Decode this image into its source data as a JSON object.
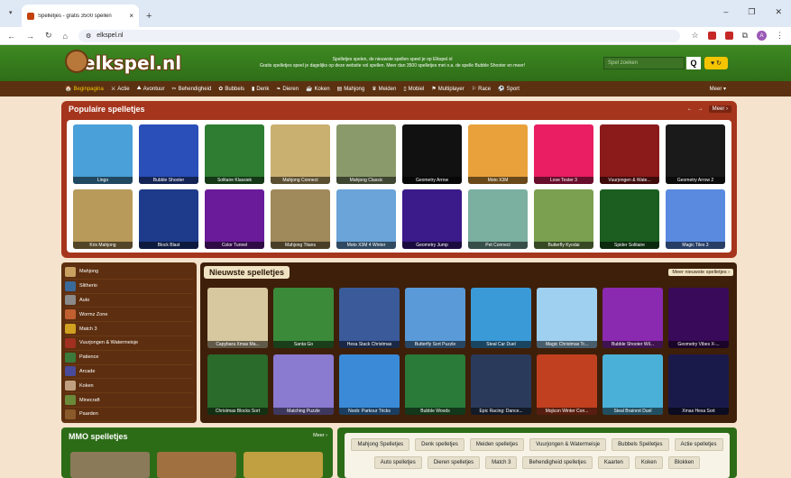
{
  "browser": {
    "tab_title": "Spelletjes - gratis 3500 spellen",
    "tab_close": "×",
    "new_tab": "+",
    "url": "elkspel.nl",
    "win_controls": [
      "–",
      "❐",
      "✕"
    ]
  },
  "header": {
    "logo": "elkspel.nl",
    "tagline_1": "Spelletjes spelen, de nieuwste spellen speel je op Elkspel.nl",
    "tagline_2": "Gratis spelletjes speel je dagelijks op deze website vol spellen. Meer dan 3500 spelletjes met o.a. de spelle Bubble Shooter en meer!",
    "search_placeholder": "Spel zoeken",
    "search_icon": "Q",
    "heart_label": "♥ ↻"
  },
  "nav": {
    "items": [
      "Beginpagina",
      "Actie",
      "Avontuur",
      "Behendigheid",
      "Bubbels",
      "Denk",
      "Dieren",
      "Koken",
      "Mahjong",
      "Meiden",
      "Mobiel",
      "Multiplayer",
      "Race",
      "Sport"
    ],
    "more": "Meer ▾"
  },
  "populaire": {
    "title": "Populaire spelletjes",
    "more": "Meer ›",
    "games": [
      "Lingo",
      "Bubble Shooter",
      "Solitaire Klassiek",
      "Mahjong Connect",
      "Mahjong Classic",
      "Geometry Arrow",
      "Moto X3M",
      "Love Tester 3",
      "Vuurjongen & Wate...",
      "Geometry Arrow 2",
      "Kris Mahjong",
      "Block Blast",
      "Color Tunnel",
      "Mahjong Titans",
      "Moto X3M 4 Winter",
      "Geometry Jump",
      "Pet Connect",
      "Butterfly Kyodai",
      "Spider Solitaire",
      "Magic Tiles 3"
    ],
    "colors": [
      "#4aa0d8",
      "#2a4fb8",
      "#2e7d32",
      "#c9b070",
      "#8a9a6a",
      "#111111",
      "#e9a23b",
      "#e91e63",
      "#8b1a1a",
      "#1a1a1a",
      "#b89a5a",
      "#1e3a8a",
      "#6a1b9a",
      "#a0895a",
      "#6aa4d8",
      "#3b1a8a",
      "#7bb0a0",
      "#7aa050",
      "#1b5e20",
      "#5a8ae0"
    ]
  },
  "categories": {
    "items": [
      "Mahjong",
      "Slitherio",
      "Auto",
      "Wormz Zone",
      "Match 3",
      "Vuurjongen & Watermeisje",
      "Patience",
      "Arcade",
      "Koken",
      "Minecraft",
      "Paarden"
    ],
    "colors": [
      "#c8a060",
      "#3a6a9a",
      "#8a8a8a",
      "#c06030",
      "#d0a020",
      "#a03020",
      "#3a7a3a",
      "#4a4a9a",
      "#c0a080",
      "#6a8a3a",
      "#8a5a2a"
    ]
  },
  "nieuwste": {
    "title": "Nieuwste spelletjes",
    "more": "Meer nieuwste spelletjes ›",
    "games": [
      "Capybara Xmas Ma...",
      "Santa Go",
      "Hexa Stack Christmas",
      "Butterfly Sort Puzzle",
      "Steal Car Duel",
      "Magic Christmas Tr...",
      "Bubble Shooter Wil...",
      "Geometry Vibes X-...",
      "Christmas Blocks Sort",
      "Matching Puzzle",
      "Noob: Parkour Tricks",
      "Bubble Woods",
      "Epic Racing: Dance...",
      "Mojicon Winter Con...",
      "Steal Brainrot Duel",
      "Xmas Hexa Sort"
    ],
    "colors": [
      "#d8c8a0",
      "#3a8a3a",
      "#3a5a9a",
      "#5a9ad8",
      "#3a9ad8",
      "#a0d0f0",
      "#8a2ab0",
      "#3a0a5a",
      "#2a6a2a",
      "#8a7ad0",
      "#3a8ad8",
      "#2a7a3a",
      "#2a3a5a",
      "#c04020",
      "#4ab0d8",
      "#1a1a4a"
    ]
  },
  "mmo": {
    "title": "MMO spelletjes",
    "more": "Meer ›"
  },
  "tags": [
    "Mahjong Spelletjes",
    "Denk spelletjes",
    "Meiden spelletjes",
    "Vuurjongen & Watermeisje",
    "Bubbels Spelletjes",
    "Actie spelletjes",
    "Auto spelletjes",
    "Dieren spelletjes",
    "Match 3",
    "Behendigheid spelletjes",
    "Kaarten",
    "Koken",
    "Blokken"
  ]
}
